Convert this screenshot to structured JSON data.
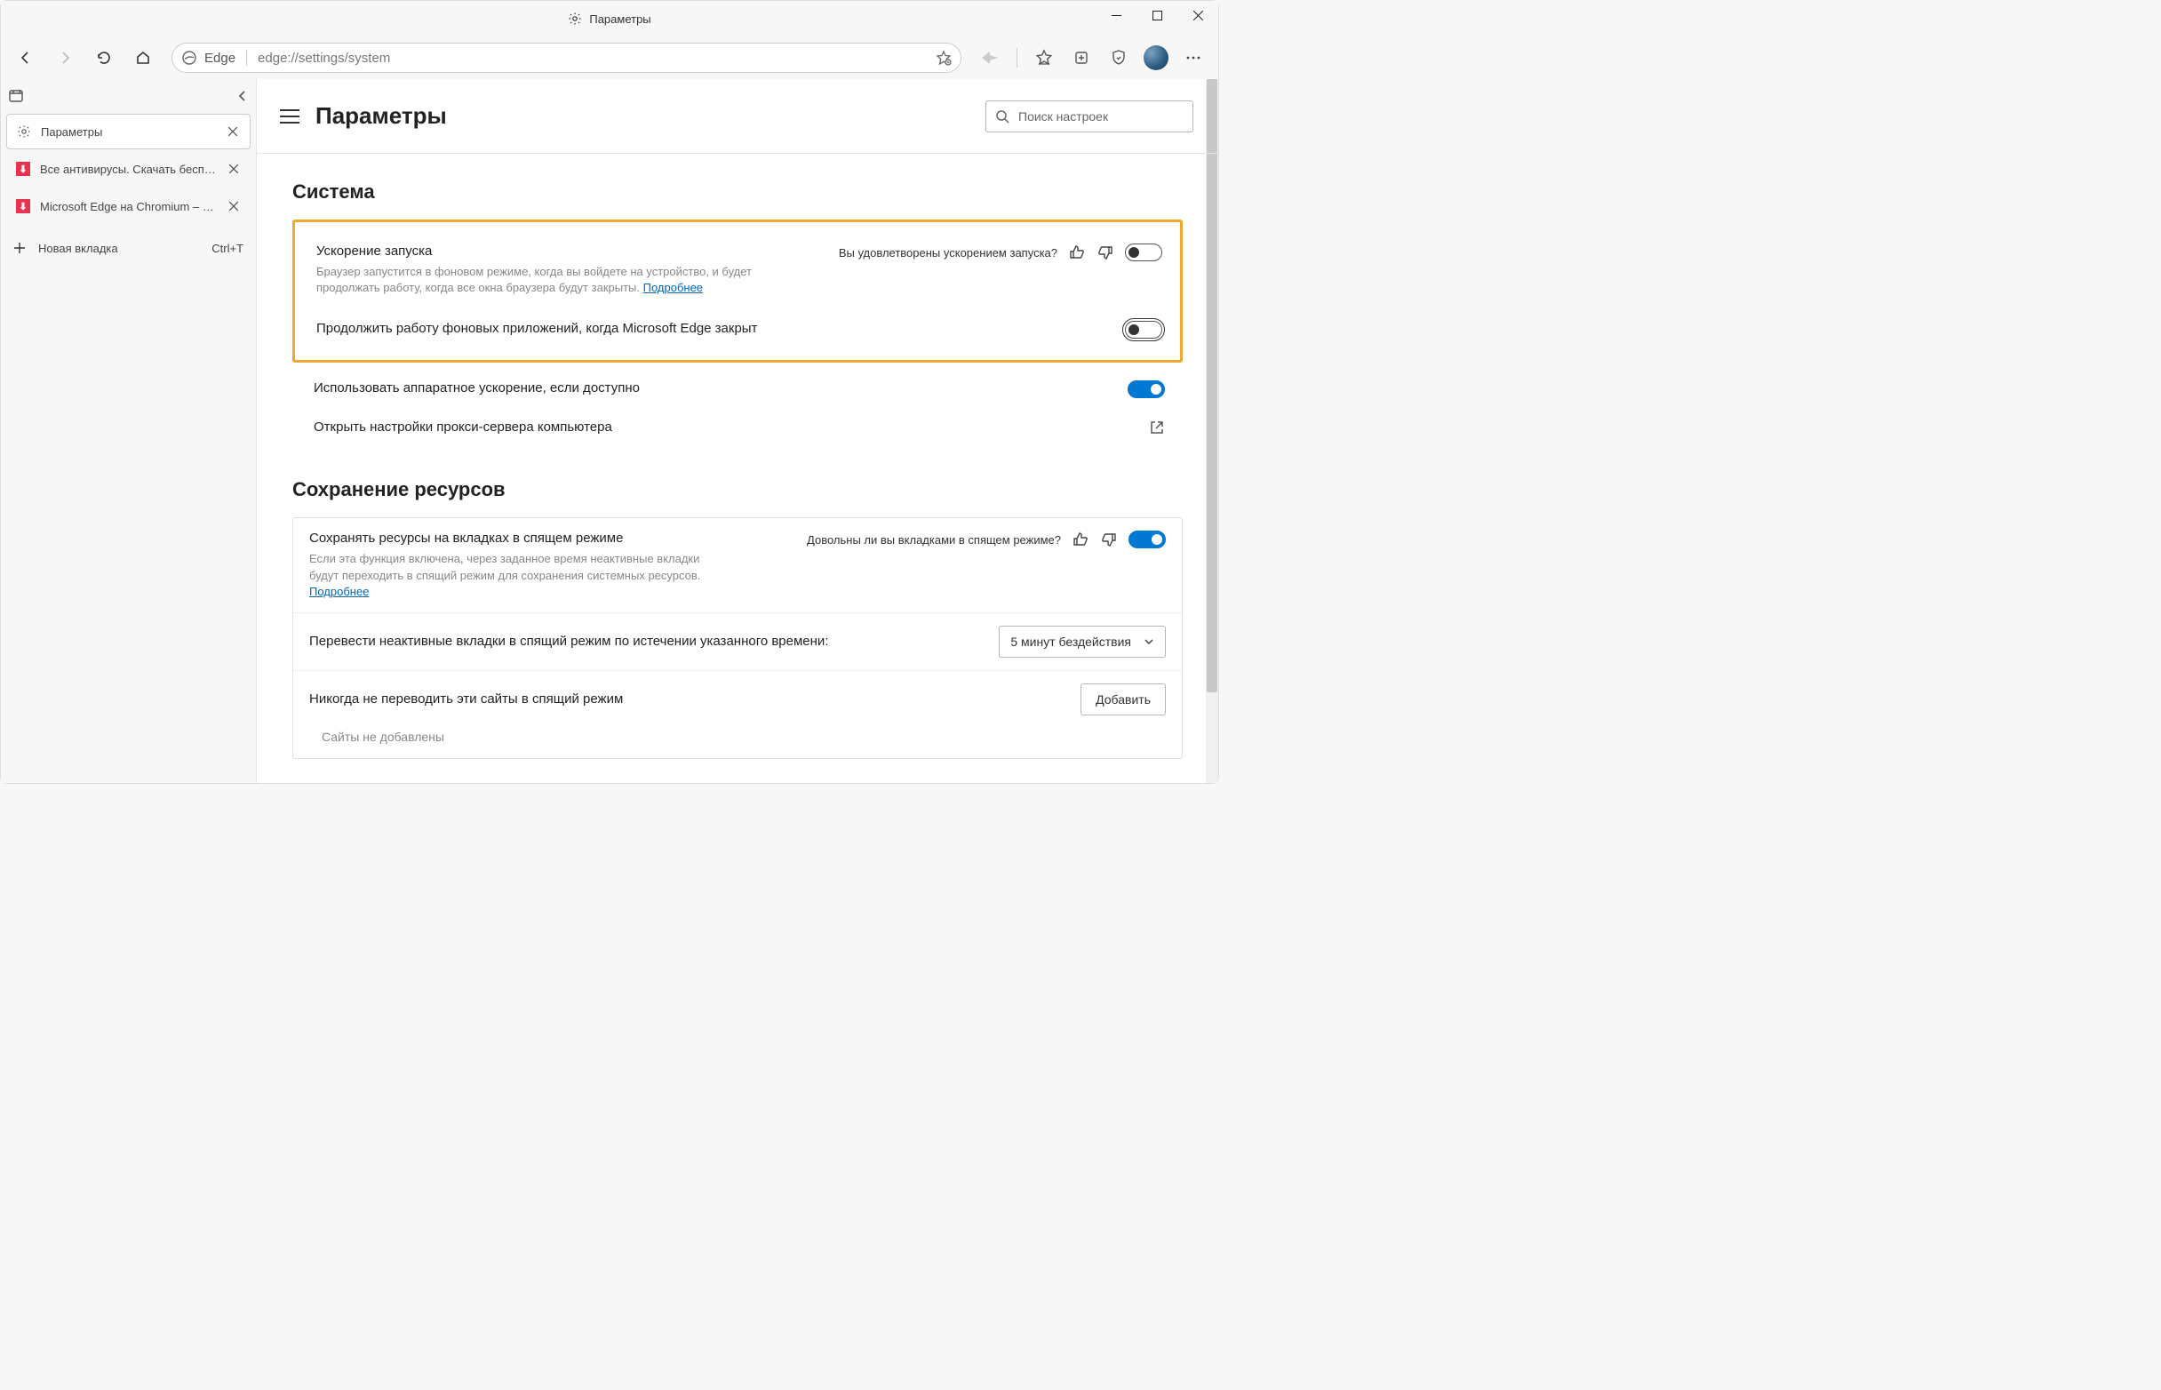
{
  "window": {
    "title": "Параметры"
  },
  "toolbar": {
    "app_label": "Edge",
    "url": "edge://settings/system"
  },
  "tabs": {
    "items": [
      {
        "label": "Параметры",
        "active": true
      },
      {
        "label": "Все антивирусы. Скачать беспл..."
      },
      {
        "label": "Microsoft Edge на Chromium – Н..."
      }
    ],
    "new_tab_label": "Новая вкладка",
    "new_tab_shortcut": "Ctrl+T"
  },
  "settings": {
    "page_title": "Параметры",
    "search_placeholder": "Поиск настроек",
    "system": {
      "heading": "Система",
      "startup_boost": {
        "title": "Ускорение запуска",
        "desc_part1": "Браузер запустится в фоновом режиме, когда вы войдете на устройство, и будет продолжать работу, когда все окна браузера будут закрыты. ",
        "learn_more": "Подробнее",
        "feedback": "Вы удовлетворены ускорением запуска?"
      },
      "background_apps": {
        "title": "Продолжить работу фоновых приложений, когда Microsoft Edge закрыт"
      },
      "hw_accel": {
        "title": "Использовать аппаратное ускорение, если доступно"
      },
      "proxy": {
        "title": "Открыть настройки прокси-сервера компьютера"
      }
    },
    "resources": {
      "heading": "Сохранение ресурсов",
      "sleeping_tabs": {
        "title": "Сохранять ресурсы на вкладках в спящем режиме",
        "desc_part1": "Если эта функция включена, через заданное время неактивные вкладки будут переходить в спящий режим для сохранения системных ресурсов. ",
        "learn_more": "Подробнее",
        "feedback": "Довольны ли вы вкладками в спящем режиме?"
      },
      "timeout": {
        "title": "Перевести неактивные вкладки в спящий режим по истечении указанного времени:",
        "selected": "5 минут бездействия"
      },
      "never_sleep": {
        "title": "Никогда не переводить эти сайты в спящий режим",
        "add_button": "Добавить",
        "empty": "Сайты не добавлены"
      }
    }
  }
}
